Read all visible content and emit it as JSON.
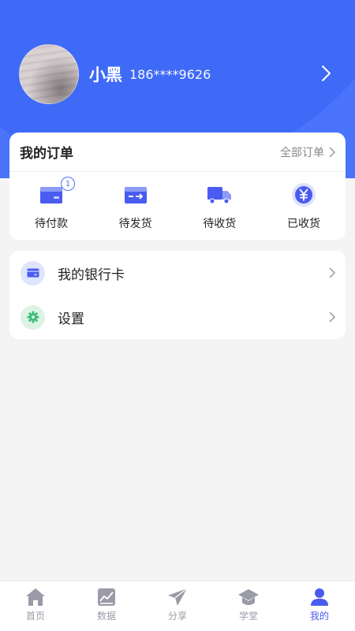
{
  "profile": {
    "name": "小黑",
    "phone": "186****9626"
  },
  "orders": {
    "title": "我的订单",
    "all_label": "全部订单",
    "items": [
      {
        "label": "待付款",
        "icon": "wallet-card-icon",
        "badge": "1"
      },
      {
        "label": "待发货",
        "icon": "shipping-card-icon"
      },
      {
        "label": "待收货",
        "icon": "delivery-truck-icon"
      },
      {
        "label": "已收货",
        "icon": "yen-coin-icon"
      }
    ]
  },
  "menu": {
    "items": [
      {
        "label": "我的银行卡",
        "icon": "bank-card-icon"
      },
      {
        "label": "设置",
        "icon": "gear-icon"
      }
    ]
  },
  "tabbar": {
    "items": [
      {
        "label": "首页",
        "icon": "home-icon"
      },
      {
        "label": "数据",
        "icon": "chart-icon"
      },
      {
        "label": "分享",
        "icon": "paper-plane-icon"
      },
      {
        "label": "学堂",
        "icon": "graduation-cap-icon"
      },
      {
        "label": "我的",
        "icon": "user-icon",
        "active": true
      }
    ]
  },
  "colors": {
    "primary": "#4a74fb",
    "header_dark": "#3f6af7",
    "tab_inactive": "#9a9aa8",
    "tab_active": "#4a5bf0",
    "settings_green": "#3bbf7a"
  }
}
